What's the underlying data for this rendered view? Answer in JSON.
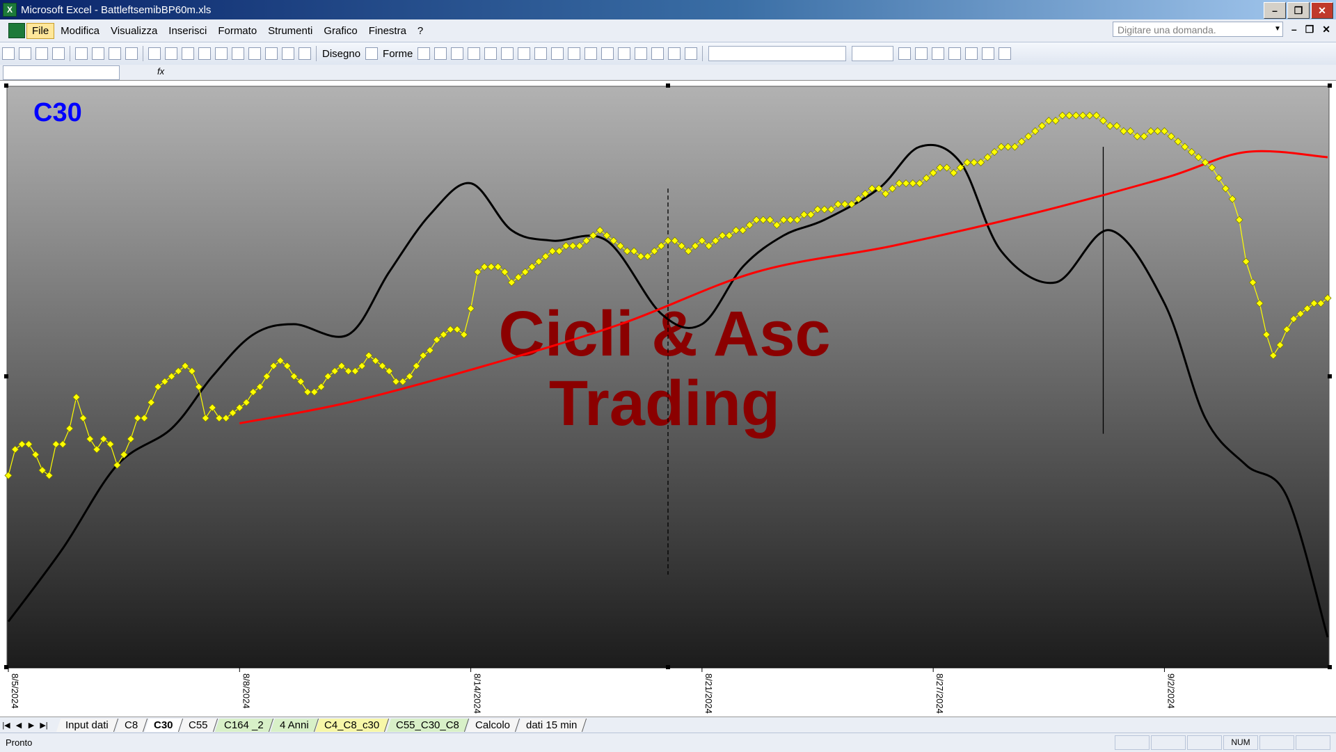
{
  "window": {
    "title": "Microsoft Excel - BattleftsemibBP60m.xls",
    "app_icon": "X"
  },
  "menu": {
    "items": [
      "File",
      "Modifica",
      "Visualizza",
      "Inserisci",
      "Formato",
      "Strumenti",
      "Grafico",
      "Finestra",
      "?"
    ],
    "help_placeholder": "Digitare una domanda."
  },
  "toolbar": {
    "draw_label": "Disegno",
    "shapes_label": "Forme"
  },
  "formula_bar": {
    "fx": "fx"
  },
  "chart": {
    "label": "C30",
    "watermark": [
      "Cicli & Asc",
      "Trading"
    ],
    "colors": {
      "price": "#ffff00",
      "price_marker_stroke": "#7a7a00",
      "moving_avg": "#ff0000",
      "cycle": "#000000",
      "background_top": "#b2b2b2",
      "background_bottom": "#1c1c1c",
      "label": "#0000ff",
      "watermark": "#8b0000"
    }
  },
  "chart_data": {
    "type": "line",
    "x_tick_labels": [
      "8/5/2024",
      "8/8/2024",
      "8/14/2024",
      "8/21/2024",
      "8/27/2024",
      "9/2/2024"
    ],
    "x_tick_index": [
      0,
      34,
      68,
      102,
      136,
      170
    ],
    "x_range": [
      0,
      194
    ],
    "y_range": [
      0,
      100
    ],
    "series": [
      {
        "style": "yellow-diamond-line",
        "x_start": 0,
        "x_step": 1,
        "values": [
          31,
          36,
          37,
          37,
          35,
          32,
          31,
          37,
          37,
          40,
          46,
          42,
          38,
          36,
          38,
          37,
          33,
          35,
          38,
          42,
          42,
          45,
          48,
          49,
          50,
          51,
          52,
          51,
          48,
          42,
          44,
          42,
          42,
          43,
          44,
          45,
          47,
          48,
          50,
          52,
          53,
          52,
          50,
          49,
          47,
          47,
          48,
          50,
          51,
          52,
          51,
          51,
          52,
          54,
          53,
          52,
          51,
          49,
          49,
          50,
          52,
          54,
          55,
          57,
          58,
          59,
          59,
          58,
          63,
          70,
          71,
          71,
          71,
          70,
          68,
          69,
          70,
          71,
          72,
          73,
          74,
          74,
          75,
          75,
          75,
          76,
          77,
          78,
          77,
          76,
          75,
          74,
          74,
          73,
          73,
          74,
          75,
          76,
          76,
          75,
          74,
          75,
          76,
          75,
          76,
          77,
          77,
          78,
          78,
          79,
          80,
          80,
          80,
          79,
          80,
          80,
          80,
          81,
          81,
          82,
          82,
          82,
          83,
          83,
          83,
          84,
          85,
          86,
          86,
          85,
          86,
          87,
          87,
          87,
          87,
          88,
          89,
          90,
          90,
          89,
          90,
          91,
          91,
          91,
          92,
          93,
          94,
          94,
          94,
          95,
          96,
          97,
          98,
          99,
          99,
          100,
          100,
          100,
          100,
          100,
          100,
          99,
          98,
          98,
          97,
          97,
          96,
          96,
          97,
          97,
          97,
          96,
          95,
          94,
          93,
          92,
          91,
          90,
          88,
          86,
          84,
          80,
          72,
          68,
          64,
          58,
          54,
          56,
          59,
          61,
          62,
          63,
          64,
          64,
          65
        ]
      },
      {
        "style": "red-line",
        "x": [
          34,
          50,
          70,
          90,
          110,
          130,
          150,
          170,
          182,
          194
        ],
        "values": [
          41,
          45,
          52,
          60,
          70,
          75,
          81,
          88,
          93,
          92
        ]
      },
      {
        "style": "black-line",
        "x": [
          0,
          8,
          16,
          24,
          30,
          36,
          42,
          50,
          56,
          62,
          68,
          74,
          80,
          88,
          96,
          102,
          108,
          114,
          120,
          128,
          134,
          140,
          146,
          154,
          162,
          170,
          176,
          182,
          188,
          194
        ],
        "values": [
          3,
          17,
          33,
          40,
          50,
          58,
          60,
          58,
          70,
          81,
          87,
          78,
          76,
          76,
          62,
          60,
          71,
          77,
          80,
          86,
          94,
          91,
          74,
          68,
          78,
          64,
          42,
          33,
          27,
          0
        ]
      }
    ],
    "vertical_markers": [
      {
        "x": 97,
        "style": "dashed",
        "y_range": [
          12,
          86
        ]
      },
      {
        "x": 161,
        "style": "solid",
        "y_range": [
          39,
          94
        ]
      }
    ]
  },
  "sheet_tabs": [
    {
      "label": "Input dati",
      "style": "plain"
    },
    {
      "label": "C8",
      "style": "plain"
    },
    {
      "label": "C30",
      "style": "active"
    },
    {
      "label": "C55",
      "style": "plain"
    },
    {
      "label": "C164 _2",
      "style": "green"
    },
    {
      "label": "4 Anni",
      "style": "green"
    },
    {
      "label": "C4_C8_c30",
      "style": "yellow"
    },
    {
      "label": "C55_C30_C8",
      "style": "green"
    },
    {
      "label": "Calcolo",
      "style": "plain"
    },
    {
      "label": "dati 15 min",
      "style": "plain"
    }
  ],
  "status": {
    "left": "Pronto",
    "num": "NUM"
  }
}
